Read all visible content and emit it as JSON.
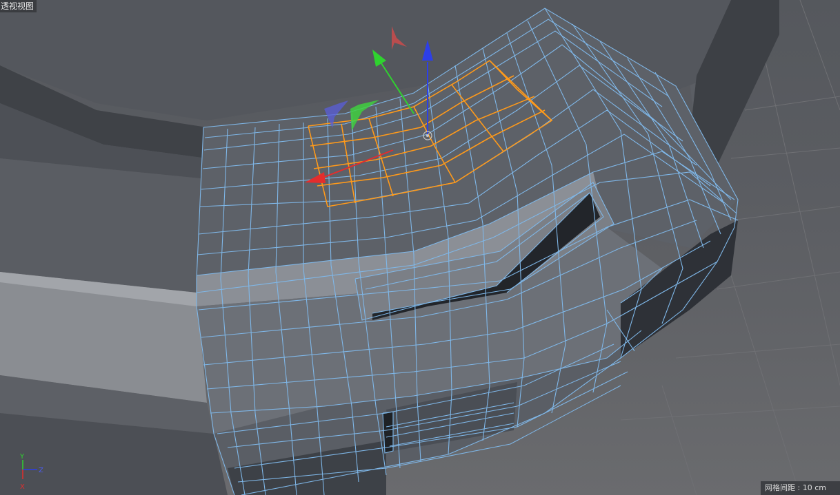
{
  "viewport": {
    "title": "透视视图",
    "grid_spacing_label": "网格间距 : 10 cm"
  },
  "axis_gizmo": {
    "labels": {
      "y": "Y",
      "z": "Z",
      "x": "X"
    }
  },
  "colors": {
    "background": "#5e6065",
    "mesh_fill": "#70747b",
    "wireframe": "#7fb7e8",
    "selection": "#ff9a1a",
    "axis_x": "#e32d2d",
    "axis_y": "#2fd22f",
    "axis_z": "#2d3fe8"
  },
  "icons": [
    "move-manipulator-icon",
    "world-axis-icon"
  ]
}
